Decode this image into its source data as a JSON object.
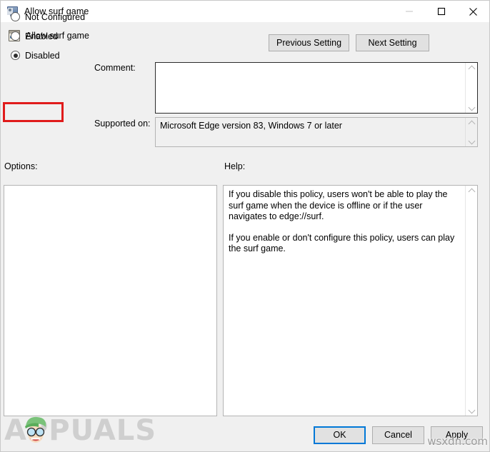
{
  "window": {
    "title": "Allow surf game",
    "icon": "monitor-icon",
    "controls": {
      "minimize": "minimize-icon",
      "maximize": "maximize-icon",
      "close": "close-icon"
    }
  },
  "header": {
    "policy_title": "Allow surf game",
    "policy_icon": "policy-setting-icon",
    "previous_setting": "Previous Setting",
    "next_setting": "Next Setting"
  },
  "state": {
    "options": [
      {
        "label": "Not Configured",
        "checked": false
      },
      {
        "label": "Enabled",
        "checked": false
      },
      {
        "label": "Disabled",
        "checked": true
      }
    ],
    "highlighted_option": "Disabled",
    "highlight_color": "#e01b1b"
  },
  "comment": {
    "label": "Comment:",
    "value": "",
    "scroll_up": "chevron-up-icon",
    "scroll_down": "chevron-down-icon"
  },
  "supported": {
    "label": "Supported on:",
    "value": "Microsoft Edge version 83, Windows 7 or later",
    "scroll_up": "chevron-up-icon",
    "scroll_down": "chevron-down-icon"
  },
  "sections": {
    "options_label": "Options:",
    "help_label": "Help:"
  },
  "options_panel": {
    "content": ""
  },
  "help_panel": {
    "paragraphs": [
      "If you disable this policy, users won't be able to play the surf game when the device is offline or if the user navigates to edge://surf.",
      "If you enable or don't configure this policy, users can play the surf game."
    ],
    "paragraph_1": "If you disable this policy, users won't be able to play the surf game when the device is offline or if the user navigates to edge://surf.",
    "paragraph_2": "If you enable or don't configure this policy, users can play the surf game.",
    "scroll_up": "chevron-up-icon",
    "scroll_down": "chevron-down-icon"
  },
  "footer": {
    "ok": "OK",
    "cancel": "Cancel",
    "apply": "Apply",
    "focused_button": "OK",
    "focus_color": "#0078d7"
  },
  "watermarks": {
    "brand": "APPUALS",
    "site": "wsxdn.com"
  }
}
